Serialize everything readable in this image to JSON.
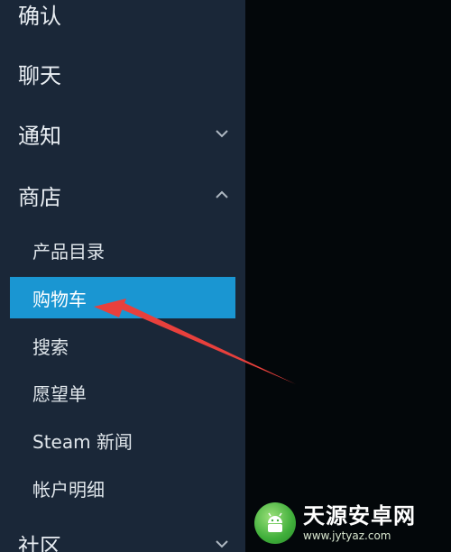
{
  "sidebar": {
    "items": [
      {
        "label": "确认"
      },
      {
        "label": "聊天"
      },
      {
        "label": "通知",
        "icon": "chevron-down-icon"
      },
      {
        "label": "商店",
        "icon": "chevron-up-icon"
      }
    ],
    "store_sub_items": [
      {
        "label": "产品目录"
      },
      {
        "label": "购物车",
        "active": true
      },
      {
        "label": "搜索"
      },
      {
        "label": "愿望单"
      },
      {
        "label": "Steam 新闻"
      },
      {
        "label": "帐户明细"
      }
    ],
    "bottom_item": {
      "label": "社区",
      "icon": "chevron-down-icon"
    }
  },
  "colors": {
    "sidebar_bg": "#1a2738",
    "active_bg": "#1a96d2",
    "arrow": "#e8403c"
  },
  "watermark": {
    "name": "天源安卓网",
    "url": "www.jytyaz.com"
  }
}
